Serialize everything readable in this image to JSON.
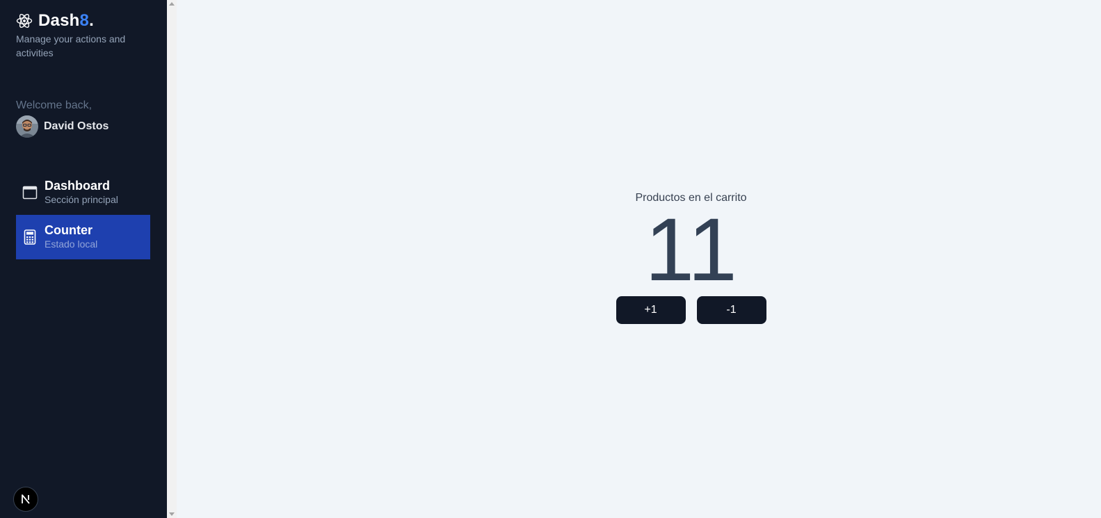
{
  "brand": {
    "name": "Dash",
    "accent": "8",
    "dot": ".",
    "tagline": "Manage your actions and activities",
    "accent_color": "#3b82f6"
  },
  "user": {
    "welcome": "Welcome back,",
    "name": "David Ostos"
  },
  "nav": {
    "items": [
      {
        "title": "Dashboard",
        "subtitle": "Sección principal",
        "icon": "browser-window-icon",
        "active": false
      },
      {
        "title": "Counter",
        "subtitle": "Estado local",
        "icon": "calculator-icon",
        "active": true
      }
    ]
  },
  "counter": {
    "label": "Productos en el carrito",
    "value": "11",
    "increment_label": "+1",
    "decrement_label": "-1"
  },
  "colors": {
    "sidebar_bg": "#111827",
    "active_item": "#1e40af",
    "main_bg": "#f1f5f9",
    "button_bg": "#111827"
  }
}
